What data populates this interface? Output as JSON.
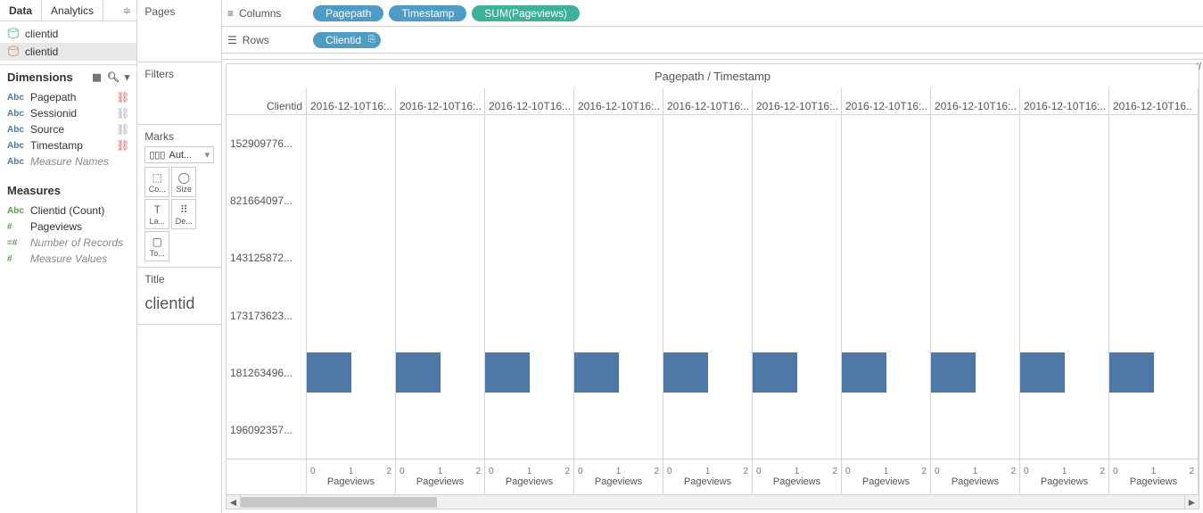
{
  "tabs": {
    "data": "Data",
    "analytics": "Analytics"
  },
  "sources": [
    "clientid",
    "clientid"
  ],
  "dimensions": {
    "header": "Dimensions",
    "items": [
      {
        "type": "Abc",
        "name": "Pagepath",
        "link": "red"
      },
      {
        "type": "Abc",
        "name": "Sessionid",
        "link": "gray"
      },
      {
        "type": "Abc",
        "name": "Source",
        "link": "gray"
      },
      {
        "type": "Abc",
        "name": "Timestamp",
        "link": "red"
      },
      {
        "type": "Abc",
        "name": "Measure Names",
        "italic": true
      }
    ]
  },
  "measures": {
    "header": "Measures",
    "items": [
      {
        "type": "Abc",
        "name": "Clientid (Count)",
        "typeClass": "meas"
      },
      {
        "type": "#",
        "name": "Pageviews",
        "typeClass": "hash"
      },
      {
        "type": "=#",
        "name": "Number of Records",
        "italic": true,
        "typeClass": "hash"
      },
      {
        "type": "#",
        "name": "Measure Values",
        "italic": true,
        "typeClass": "hash"
      }
    ]
  },
  "cards": {
    "pages": "Pages",
    "filters": "Filters",
    "marks": "Marks",
    "marks_type": "Aut...",
    "mark_btns": [
      {
        "icon": "⬚",
        "label": "Co..."
      },
      {
        "icon": "◯",
        "label": "Size"
      },
      {
        "icon": "T",
        "label": "La..."
      },
      {
        "icon": "⠿",
        "label": "De..."
      },
      {
        "icon": "▢",
        "label": "To..."
      }
    ],
    "title": "Title",
    "title_text": "clientid"
  },
  "shelves": {
    "columns_label": "Columns",
    "rows_label": "Rows",
    "columns": [
      {
        "label": "Pagepath",
        "kind": "dim"
      },
      {
        "label": "Timestamp",
        "kind": "dim"
      },
      {
        "label": "SUM(Pageviews)",
        "kind": "meas"
      }
    ],
    "rows": [
      {
        "label": "Clientid",
        "kind": "dim",
        "icon": true
      }
    ]
  },
  "viz": {
    "title": "Pagepath / Timestamp",
    "row_header": "Clientid",
    "top_right_mark": "'/",
    "cols": [
      "2016-12-10T16:..",
      "2016-12-10T16:..",
      "2016-12-10T16:..",
      "2016-12-10T16:..",
      "2016-12-10T16:..",
      "2016-12-10T16:..",
      "2016-12-10T16:..",
      "2016-12-10T16:..",
      "2016-12-10T16:..",
      "2016-12-10T16.."
    ],
    "rows": [
      "152909776...",
      "821664097...",
      "143125872...",
      "173173623...",
      "181263496...",
      "196092357..."
    ],
    "axis_label": "Pageviews",
    "axis_ticks": [
      "0",
      "1",
      "2"
    ],
    "bar_row_index": 4
  },
  "chart_data": {
    "type": "bar",
    "title": "Pagepath / Timestamp",
    "xlabel": "Pageviews",
    "ylabel": "Clientid",
    "x_ticks": [
      0,
      1,
      2
    ],
    "row_categories": [
      "152909776...",
      "821664097...",
      "143125872...",
      "173173623...",
      "181263496...",
      "196092357..."
    ],
    "col_categories": [
      "2016-12-10T16:..",
      "2016-12-10T16:..",
      "2016-12-10T16:..",
      "2016-12-10T16:..",
      "2016-12-10T16:..",
      "2016-12-10T16:..",
      "2016-12-10T16:..",
      "2016-12-10T16:..",
      "2016-12-10T16:..",
      "2016-12-10T16.."
    ],
    "series": [
      {
        "name": "152909776...",
        "values": [
          0,
          0,
          0,
          0,
          0,
          0,
          0,
          0,
          0,
          0
        ]
      },
      {
        "name": "821664097...",
        "values": [
          0,
          0,
          0,
          0,
          0,
          0,
          0,
          0,
          0,
          0
        ]
      },
      {
        "name": "143125872...",
        "values": [
          0,
          0,
          0,
          0,
          0,
          0,
          0,
          0,
          0,
          0
        ]
      },
      {
        "name": "173173623...",
        "values": [
          0,
          0,
          0,
          0,
          0,
          0,
          0,
          0,
          0,
          0
        ]
      },
      {
        "name": "181263496...",
        "values": [
          1,
          1,
          1,
          1,
          1,
          1,
          1,
          1,
          1,
          1
        ]
      },
      {
        "name": "196092357...",
        "values": [
          0,
          0,
          0,
          0,
          0,
          0,
          0,
          0,
          0,
          0
        ]
      }
    ],
    "xlim": [
      0,
      2
    ]
  }
}
